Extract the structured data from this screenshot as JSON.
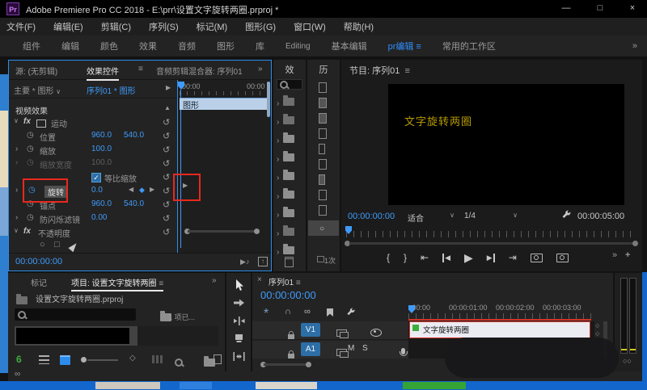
{
  "colors": {
    "accent": "#2d8ceb",
    "value_blue": "#3f9bfa",
    "annotation_red": "#e8281e",
    "clip_border_red": "#d23428",
    "fx_badge_green": "#3cae3c",
    "overlay_yellow": "#b89b00",
    "taskbar_blue": "#1266cc"
  },
  "window": {
    "logo": "Pr",
    "title": "Adobe Premiere Pro CC 2018 - E:\\prr\\设置文字旋转两圈.prproj *",
    "minimize": "—",
    "maximize": "□",
    "close": "×"
  },
  "menu": {
    "items": [
      "文件(F)",
      "编辑(E)",
      "剪辑(C)",
      "序列(S)",
      "标记(M)",
      "图形(G)",
      "窗口(W)",
      "帮助(H)"
    ]
  },
  "workspace": {
    "tabs": [
      "组件",
      "编辑",
      "颜色",
      "效果",
      "音频",
      "图形",
      "库",
      "Editing",
      "基本编辑",
      "pr编辑",
      "常用的工作区"
    ]
  },
  "icons": {
    "menu": "≡",
    "overflow": "»",
    "chevron_down": "∨",
    "twirl_closed": "›",
    "twirl_open": "∨",
    "reset": "↺",
    "collapse_up": "▲",
    "stopwatch": "◷",
    "kf_prev": "◀",
    "kf_add": "◆",
    "kf_next": "▶",
    "arrow_right": "▶",
    "ellipse": "○",
    "rect": "□",
    "play": "▶",
    "brace_in": "{",
    "brace_out": "}",
    "goto_in": "⇤",
    "goto_out": "⇥",
    "step_back": "◀",
    "step_fwd": "▶",
    "plus": "+",
    "close": "×",
    "magnet": "∩",
    "link": "∞",
    "snap": "*",
    "note": "♪",
    "export_up": "↑",
    "sort": "◇",
    "check": "✓",
    "writable": "6"
  },
  "effect_controls": {
    "tab_source": "源: (无剪辑)",
    "tab_active": "效果控件",
    "tab_mixer": "音频剪辑混合器: 序列01",
    "selector_master": "主要 * 图形",
    "selector_sequence": "序列01 * 图形",
    "ruler_start": "00:00",
    "ruler_end": "00:00",
    "clip_bar": "图形",
    "section_video": "视频效果",
    "rows": {
      "motion": {
        "label": "运动"
      },
      "position": {
        "label": "位置",
        "v1": "960.0",
        "v2": "540.0"
      },
      "scale": {
        "label": "缩放",
        "v1": "100.0"
      },
      "scale_width": {
        "label": "缩放宽度",
        "v1": "100.0"
      },
      "uniform": {
        "label": "等比缩放"
      },
      "rotation": {
        "label": "旋转",
        "v1": "0.0"
      },
      "anchor": {
        "label": "锚点",
        "v1": "960.0",
        "v2": "540.0"
      },
      "antiflicker": {
        "label": "防闪烁滤镜",
        "v1": "0.00"
      },
      "opacity": {
        "label": "不透明度"
      }
    },
    "timecode": "00:00:00:00"
  },
  "effects_panel": {
    "title": "效"
  },
  "history_panel": {
    "title": "历",
    "footer": "1次"
  },
  "program": {
    "title": "节目: 序列01",
    "overlay_text": "文字旋转两圈",
    "timecode": "00:00:00:00",
    "fit": "适合",
    "resolution": "1/4",
    "duration": "00:00:05:00"
  },
  "project": {
    "tab_markers": "标记",
    "tab_title": "项目: 设置文字旋转两圈",
    "file_name": "设置文字旋转两圈.prproj",
    "count": "1 项已..."
  },
  "timeline": {
    "tab": "序列01",
    "timecode": "00:00:00:00",
    "ruler": [
      ":00:00",
      "00:00:01:00",
      "00:00:02:00",
      "00:00:03:00"
    ],
    "v1": "V1",
    "a1": "A1",
    "mute": "M",
    "solo": "S",
    "clip_name": "文字旋转两圈"
  }
}
